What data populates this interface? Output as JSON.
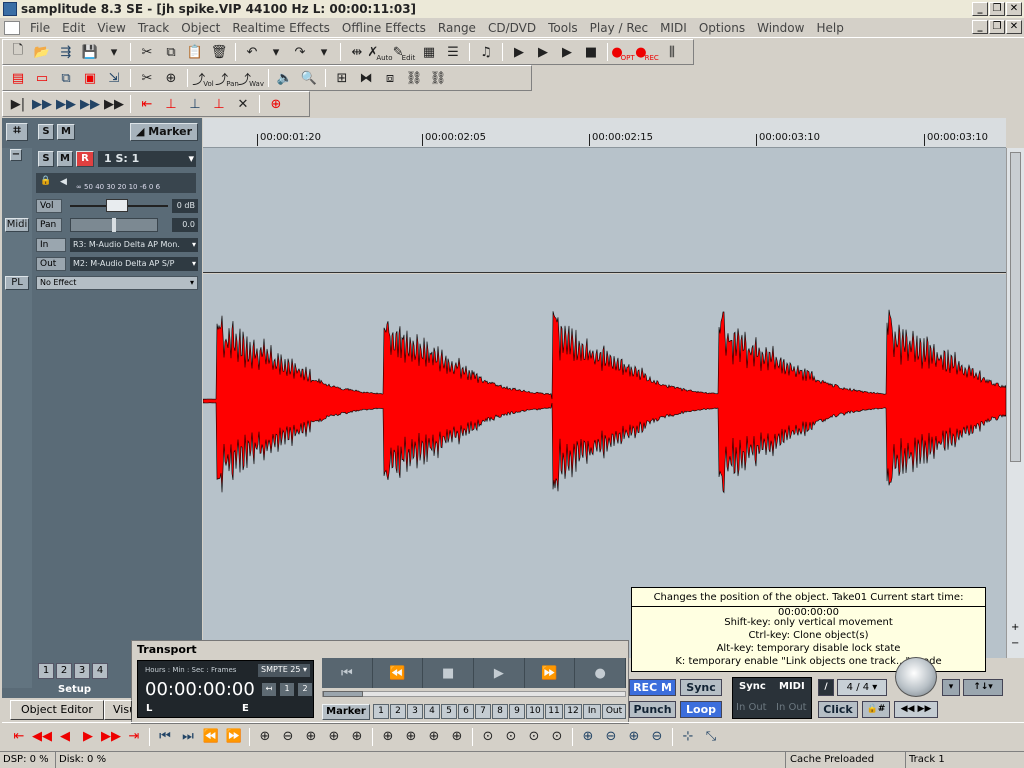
{
  "window": {
    "title": "samplitude 8.3 SE - [jh spike.VIP   44100 Hz L: 00:00:11:03]",
    "controls": [
      "_",
      "❐",
      "✕"
    ],
    "mdi_controls": [
      "_",
      "❐",
      "✕"
    ]
  },
  "menu": [
    "File",
    "Edit",
    "View",
    "Track",
    "Object",
    "Realtime Effects",
    "Offline Effects",
    "Range",
    "CD/DVD",
    "Tools",
    "Play / Rec",
    "MIDI",
    "Options",
    "Window",
    "Help"
  ],
  "toolbar1": {
    "icons": [
      "new-icon",
      "open-icon",
      "arrange-icon",
      "save-icon",
      "cut-icon",
      "copy-icon",
      "paste-icon",
      "delete-icon",
      "undo-icon",
      "redo-icon",
      "split-icon",
      "auto-icon",
      "edit-icon",
      "grid-icon",
      "lines-icon",
      "midi-icon",
      "play-icon",
      "play-from-icon",
      "play-sel-icon",
      "stop-icon",
      "opt-icon",
      "rec-icon",
      "mixer-icon"
    ],
    "auto_label": "Auto",
    "edit_label": "Edit",
    "opt_label": "OPT",
    "rec_label": "REC"
  },
  "toolbar2": {
    "vol_label": "Vol",
    "pan_label": "Pan",
    "wav_label": "Wav"
  },
  "track_panel": {
    "s_label": "S",
    "m_label": "M",
    "r_label": "R",
    "marker_label": "Marker",
    "minus_label": "−",
    "track_info": "1   S: 1",
    "meter_scale": "∞  50 40 30 20  10 -6   0   6",
    "vol_label": "Vol",
    "vol_value": "0 dB",
    "pan_label": "Pan",
    "pan_value": "0.0",
    "in_label": "In",
    "in_value": "R3: M-Audio Delta AP Mon.",
    "out_label": "Out",
    "out_value": "M2: M-Audio Delta AP S/P",
    "midi_label": "Midi",
    "pl_label": "PL",
    "effect_value": "No Effect",
    "setup_label": "Setup",
    "setup_nums": [
      "1",
      "2",
      "3",
      "4"
    ]
  },
  "ruler": {
    "ticks": [
      "00:00:01:20",
      "00:00:02:05",
      "00:00:02:15",
      "00:00:03:10"
    ]
  },
  "tooltip": {
    "title": "Changes the position of the object. Take01 Current start time: 00:00:00:00",
    "lines": [
      "Shift-key: only vertical movement",
      "Ctrl-key: Clone object(s)",
      "Alt-key: temporary disable lock state",
      "K: temporary enable \"Link objects one track...\" mode"
    ]
  },
  "transport": {
    "title": "Transport",
    "header_labels": "Hours : Min  : Sec : Frames",
    "smpte": "SMPTE 25",
    "time": "00:00:00:00",
    "l_label": "L",
    "e_label": "E",
    "small_btns": [
      "↤",
      "1",
      "2"
    ],
    "marker_label": "Marker",
    "markers": [
      "1",
      "2",
      "3",
      "4",
      "5",
      "6",
      "7",
      "8",
      "9",
      "10",
      "11",
      "12",
      "In",
      "Out"
    ],
    "controls": [
      "⏮",
      "⏪",
      "■",
      "▶",
      "⏩",
      "●"
    ],
    "rec_m": "REC M",
    "sync": "Sync",
    "punch": "Punch",
    "loop": "Loop",
    "sync_box": "Sync",
    "midi_box": "MIDI",
    "in_out_1": "In Out",
    "in_out_2": "In Out",
    "signature": "4 / 4",
    "click": "Click",
    "hash": "🔒#",
    "nav": "◀◀ ▶▶"
  },
  "bottom": {
    "object_editor": "Object Editor",
    "vis_label": "Visu"
  },
  "status": {
    "dsp": "DSP: 0 %",
    "disk": "Disk: 0 %",
    "cache": "Cache Preloaded",
    "track": "Track 1"
  },
  "colors": {
    "waveform": "#ff0000",
    "waveform_outline": "#000000",
    "panel_dark": "#5a6b77",
    "track_bg": "#b7c2ca",
    "tooltip_bg": "#ffffe1",
    "rec_m_bg": "#3c6edc",
    "loop_bg": "#3c6edc"
  }
}
